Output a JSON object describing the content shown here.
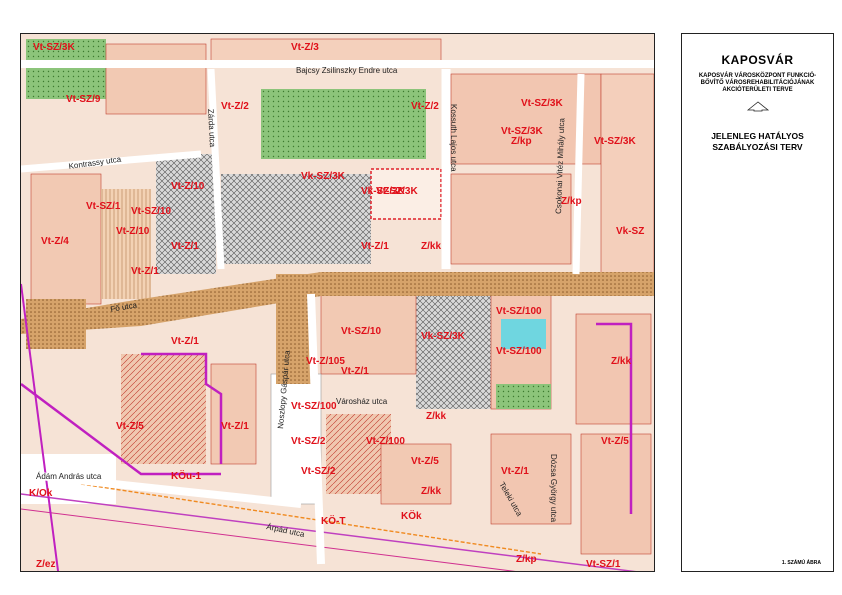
{
  "legend": {
    "title": "KAPOSVÁR",
    "subtitle_line1": "KAPOSVÁR VÁROSKÖZPONT FUNKCIÓ-",
    "subtitle_line2": "BŐVÍTŐ VÁROSREHABILITÁCIÓJÁNAK",
    "subtitle_line3": "AKCIÓTERÜLETI TERVE",
    "plan_line1": "JELENLEG HATÁLYOS",
    "plan_line2": "SZABÁLYOZÁSI TERV",
    "figure_label": "1. SZÁMÚ ÁBRA"
  },
  "streets": {
    "bajcsy": "Bajcsy Zsilinszky Endre utca",
    "kontrassy": "Kontrassy utca",
    "zarda": "Zárda utca",
    "kossuth": "Kossuth Lajos utca",
    "csokonai": "Csokonai Vitéz Mihály utca",
    "adam": "Ádám András utca",
    "teleki": "Teleki utca",
    "noszlopy": "Noszlopy Gáspár utca",
    "varoshaz": "Városház utca",
    "fo": "Fő utca",
    "dozsa": "Dózsa György utca",
    "arpad": "Árpád utca"
  },
  "zones": [
    "Vt-SZ/3K",
    "Vt-SZ/9",
    "Vt-Z/3",
    "Vt-Z/2",
    "Vt-SZ/3K",
    "Vt-SZ/3K",
    "Vt-SZ/3K",
    "Vt-Z/2",
    "Vt-SZ/1",
    "Vt-SZ/10",
    "Vt-Z/10",
    "Vt-Z/1",
    "Vt-Z/4",
    "Vt-Z/10",
    "Vk-SZ/3K",
    "Vk-SZ/3K",
    "Vt-Z/1",
    "Z/kk",
    "Z/kp",
    "Z/kp",
    "Vk-SZ/3K",
    "Vt-SZ/3K",
    "Vk-SZ",
    "Vt-Z/1",
    "Vt-SZ/10",
    "Vt-SZ/100",
    "Vt-SZ/100",
    "Z/kk",
    "Vt-Z/105",
    "Vt-Z/1",
    "Vt-Z/1",
    "Vt-SZ/100",
    "Vt-SZ/2",
    "Vt-Z/100",
    "Vt-Z/5",
    "Vt-Z/1",
    "Z/kk",
    "Vt-Z/5",
    "Vt-SZ/2",
    "Vt-Z/5",
    "Vt-Z/1",
    "K/Ok",
    "KÖu-1",
    "Z/kp",
    "Z/ez",
    "Vt-SZ/1",
    "Z/kk",
    "KÖ-T",
    "KÖk"
  ]
}
